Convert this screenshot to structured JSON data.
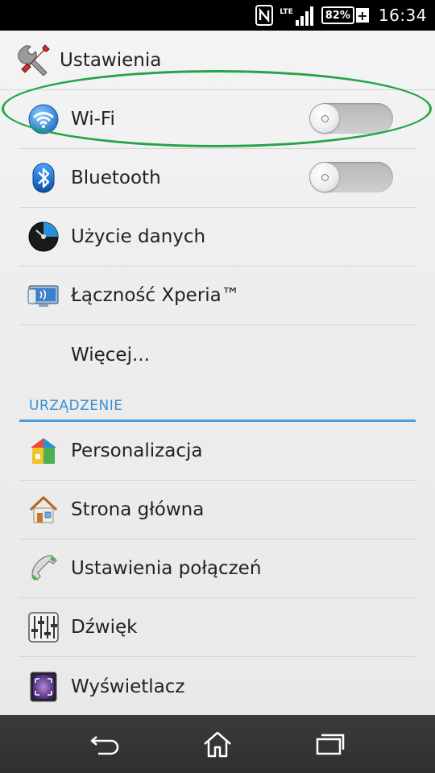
{
  "status_bar": {
    "network_type": "LTE",
    "battery_percent": "82%",
    "battery_charging_symbol": "+",
    "time": "16:34",
    "icons": [
      "nfc-icon",
      "signal-icon",
      "battery-icon"
    ]
  },
  "action_bar": {
    "title": "Ustawienia",
    "icon": "tools-icon"
  },
  "wireless_section": {
    "items": [
      {
        "label": "Wi-Fi",
        "icon": "wifi-icon",
        "toggle": true,
        "toggle_on": false
      },
      {
        "label": "Bluetooth",
        "icon": "bluetooth-icon",
        "toggle": true,
        "toggle_on": false
      },
      {
        "label": "Użycie danych",
        "icon": "data-usage-icon",
        "toggle": false
      },
      {
        "label": "Łączność Xperia™",
        "icon": "xperia-connectivity-icon",
        "toggle": false
      },
      {
        "label": "Więcej...",
        "icon": "",
        "toggle": false
      }
    ]
  },
  "device_section": {
    "header": "URZĄDZENIE",
    "items": [
      {
        "label": "Personalizacja",
        "icon": "personalization-icon"
      },
      {
        "label": "Strona główna",
        "icon": "home-screen-icon"
      },
      {
        "label": "Ustawienia połączeń",
        "icon": "call-settings-icon"
      },
      {
        "label": "Dźwięk",
        "icon": "sound-icon"
      },
      {
        "label": "Wyświetlacz",
        "icon": "display-icon"
      }
    ]
  },
  "colors": {
    "accent_blue": "#3a8fd1",
    "highlight_green": "#24a648",
    "panel_bg": "#efefef",
    "nav_bg": "#333333"
  },
  "nav_bar": {
    "buttons": [
      "back-icon",
      "home-icon",
      "recent-apps-icon"
    ]
  }
}
